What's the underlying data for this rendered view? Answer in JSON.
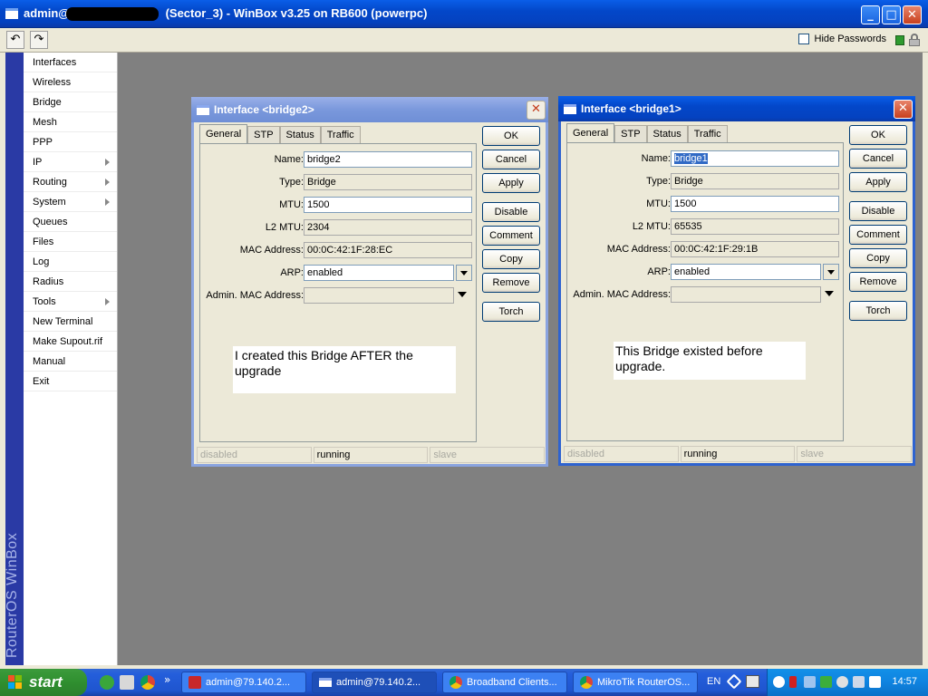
{
  "window": {
    "title_prefix": "admin@",
    "title_suffix": " (Sector_3) - WinBox v3.25 on RB600 (powerpc)",
    "min_glyph": "_",
    "max_glyph": "□",
    "close_glyph": "✕"
  },
  "toolbar": {
    "undo_glyph": "↶",
    "redo_glyph": "↷",
    "hide_passwords_label": "Hide Passwords",
    "hide_passwords_checked": false,
    "status_color": "#2e9a2e"
  },
  "sidebar": {
    "brand": "RouterOS WinBox",
    "items": [
      {
        "label": "Interfaces",
        "submenu": false
      },
      {
        "label": "Wireless",
        "submenu": false
      },
      {
        "label": "Bridge",
        "submenu": false
      },
      {
        "label": "Mesh",
        "submenu": false
      },
      {
        "label": "PPP",
        "submenu": false
      },
      {
        "label": "IP",
        "submenu": true
      },
      {
        "label": "Routing",
        "submenu": true
      },
      {
        "label": "System",
        "submenu": true
      },
      {
        "label": "Queues",
        "submenu": false
      },
      {
        "label": "Files",
        "submenu": false
      },
      {
        "label": "Log",
        "submenu": false
      },
      {
        "label": "Radius",
        "submenu": false
      },
      {
        "label": "Tools",
        "submenu": true
      },
      {
        "label": "New Terminal",
        "submenu": false
      },
      {
        "label": "Make Supout.rif",
        "submenu": false
      },
      {
        "label": "Manual",
        "submenu": false
      },
      {
        "label": "Exit",
        "submenu": false
      }
    ]
  },
  "dialogs": {
    "bridge2": {
      "title": "Interface <bridge2>",
      "close_glyph": "✕",
      "tabs": [
        "General",
        "STP",
        "Status",
        "Traffic"
      ],
      "active_tab": "General",
      "labels": {
        "name": "Name:",
        "type": "Type:",
        "mtu": "MTU:",
        "l2mtu": "L2 MTU:",
        "mac": "MAC Address:",
        "arp": "ARP:",
        "admin_mac": "Admin. MAC Address:"
      },
      "values": {
        "name": "bridge2",
        "type": "Bridge",
        "mtu": "1500",
        "l2mtu": "2304",
        "mac": "00:0C:42:1F:28:EC",
        "arp": "enabled",
        "admin_mac": ""
      },
      "note": "I created this Bridge AFTER the upgrade",
      "buttons": [
        "OK",
        "Cancel",
        "Apply",
        "Disable",
        "Comment",
        "Copy",
        "Remove",
        "Torch"
      ],
      "status": [
        "disabled",
        "running",
        "slave"
      ]
    },
    "bridge1": {
      "title": "Interface <bridge1>",
      "close_glyph": "✕",
      "tabs": [
        "General",
        "STP",
        "Status",
        "Traffic"
      ],
      "active_tab": "General",
      "labels": {
        "name": "Name:",
        "type": "Type:",
        "mtu": "MTU:",
        "l2mtu": "L2 MTU:",
        "mac": "MAC Address:",
        "arp": "ARP:",
        "admin_mac": "Admin. MAC Address:"
      },
      "values": {
        "name": "bridge1",
        "type": "Bridge",
        "mtu": "1500",
        "l2mtu": "65535",
        "mac": "00:0C:42:1F:29:1B",
        "arp": "enabled",
        "admin_mac": ""
      },
      "note": "This Bridge existed before upgrade.",
      "buttons": [
        "OK",
        "Cancel",
        "Apply",
        "Disable",
        "Comment",
        "Copy",
        "Remove",
        "Torch"
      ],
      "status": [
        "disabled",
        "running",
        "slave"
      ]
    }
  },
  "taskbar": {
    "start_label": "start",
    "overflow_glyph": "»",
    "tasks": [
      {
        "label": "admin@79.140.2...",
        "icon": "winbox-icon"
      },
      {
        "label": "admin@79.140.2...",
        "icon": "window-icon"
      },
      {
        "label": "Broadband Clients...",
        "icon": "chrome-icon"
      },
      {
        "label": "MikroTik RouterOS...",
        "icon": "chrome-icon"
      }
    ],
    "language": "EN",
    "clock": "14:57"
  }
}
